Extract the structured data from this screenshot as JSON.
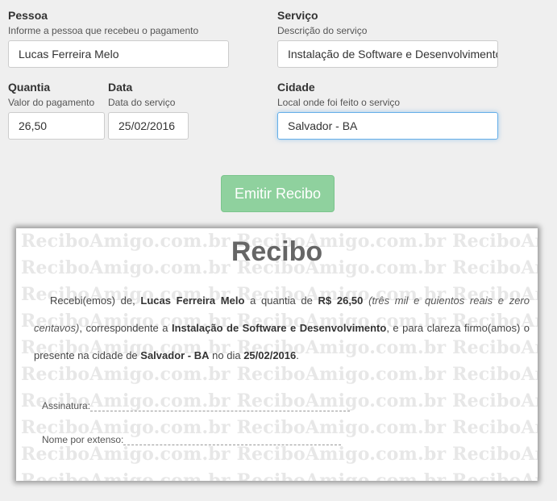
{
  "form": {
    "pessoa": {
      "label": "Pessoa",
      "hint": "Informe a pessoa que recebeu o pagamento",
      "value": "Lucas Ferreira Melo"
    },
    "servico": {
      "label": "Serviço",
      "hint": "Descrição do serviço",
      "value": "Instalação de Software e Desenvolvimento"
    },
    "quantia": {
      "label": "Quantia",
      "hint": "Valor do pagamento",
      "value": "26,50"
    },
    "data": {
      "label": "Data",
      "hint": "Data do serviço",
      "value": "25/02/2016"
    },
    "cidade": {
      "label": "Cidade",
      "hint": "Local onde foi feito o serviço",
      "value": "Salvador - BA"
    }
  },
  "button": {
    "label": "Emitir Recibo",
    "color": "#8fd19e"
  },
  "receipt": {
    "watermark": "ReciboAmigo.com.br",
    "title": "Recibo",
    "t1": "Recebi(emos) de, ",
    "nome": "Lucas Ferreira Melo",
    "t2": " a quantia de ",
    "valor": "R$ 26,50",
    "t3": " ",
    "extenso": "(três mil e quientos reais e zero centavos)",
    "t4": ", correspondente a ",
    "servico": "Instalação de Software e Desenvolvimento",
    "t5": ", e para clareza firmo(amos) o presente na cidade de ",
    "cidade": "Salvador - BA",
    "t6": " no dia ",
    "data": "25/02/2016",
    "t7": ".",
    "assinatura_label": "Assinatura:",
    "nome_extenso_label": "Nome por extenso:"
  }
}
